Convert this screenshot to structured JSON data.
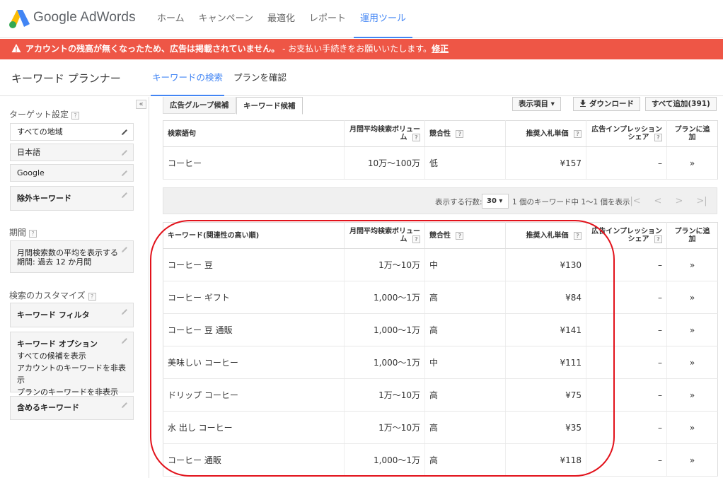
{
  "app": {
    "logo_text": "Google AdWords",
    "nav": [
      "ホーム",
      "キャンペーン",
      "最適化",
      "レポート",
      "運用ツール"
    ],
    "active_nav_index": 4
  },
  "alert": {
    "message_bold": "アカウントの残高が無くなったため、広告は掲載されていません。",
    "message": " - お支払い手続きをお願いいたします。",
    "link": "修正",
    "color": "#ee5646"
  },
  "planner": {
    "title": "キーワード プランナー",
    "tabs": [
      "キーワードの検索",
      "プランを確認"
    ]
  },
  "sidebar": {
    "collapse_icon": "«",
    "targeting_title": "ターゲット設定",
    "targeting": [
      "すべての地域",
      "日本語",
      "Google",
      "除外キーワード"
    ],
    "period_title": "期間",
    "period_line1": "月間検索数の平均を表示する",
    "period_line2": "期間: 過去 12 か月間",
    "customize_title": "検索のカスタマイズ",
    "keyword_filter": "キーワード フィルタ",
    "keyword_options": "キーワード オプション",
    "options": [
      "すべての候補を表示",
      "アカウントのキーワードを非表示",
      "プランのキーワードを非表示"
    ],
    "include_keywords": "含めるキーワード",
    "help": "?"
  },
  "toolbar": {
    "tabs": [
      "広告グループ候補",
      "キーワード候補"
    ],
    "columns_btn": "表示項目 ▾",
    "download_btn": "ダウンロード",
    "add_all_btn": "すべて追加(391)"
  },
  "search_table": {
    "headers": [
      "検索語句",
      "月間平均検索ボリューム",
      "競合性",
      "推奨入札単価",
      "広告インプレッションシェア",
      "プランに追加"
    ],
    "rows": [
      {
        "keyword": "コーヒー",
        "volume": "10万～100万",
        "competition": "低",
        "bid": "¥157",
        "share": "–",
        "add": "»"
      }
    ]
  },
  "pager": {
    "rows_label": "表示する行数:",
    "rows_value": "30",
    "summary": "1 個のキーワード中 1～1 個を表示",
    "first": "|<",
    "prev": "<",
    "next": ">",
    "last": ">|"
  },
  "ideas_table": {
    "headers": [
      "キーワード(関連性の高い順)",
      "月間平均検索ボリューム",
      "競合性",
      "推奨入札単価",
      "広告インプレッションシェア",
      "プランに追加"
    ],
    "rows": [
      {
        "keyword": "コーヒー 豆",
        "volume": "1万～10万",
        "competition": "中",
        "bid": "¥130",
        "share": "–",
        "add": "»"
      },
      {
        "keyword": "コーヒー ギフト",
        "volume": "1,000～1万",
        "competition": "高",
        "bid": "¥84",
        "share": "–",
        "add": "»"
      },
      {
        "keyword": "コーヒー 豆 通販",
        "volume": "1,000～1万",
        "competition": "高",
        "bid": "¥141",
        "share": "–",
        "add": "»"
      },
      {
        "keyword": "美味しい コーヒー",
        "volume": "1,000～1万",
        "competition": "中",
        "bid": "¥111",
        "share": "–",
        "add": "»"
      },
      {
        "keyword": "ドリップ コーヒー",
        "volume": "1万～10万",
        "competition": "高",
        "bid": "¥75",
        "share": "–",
        "add": "»"
      },
      {
        "keyword": "水 出し コーヒー",
        "volume": "1万～10万",
        "competition": "高",
        "bid": "¥35",
        "share": "–",
        "add": "»"
      },
      {
        "keyword": "コーヒー 通販",
        "volume": "1,000～1万",
        "competition": "高",
        "bid": "¥118",
        "share": "–",
        "add": "»"
      }
    ]
  },
  "colors": {
    "accent": "#4285f4",
    "highlight": "#e2121b"
  }
}
